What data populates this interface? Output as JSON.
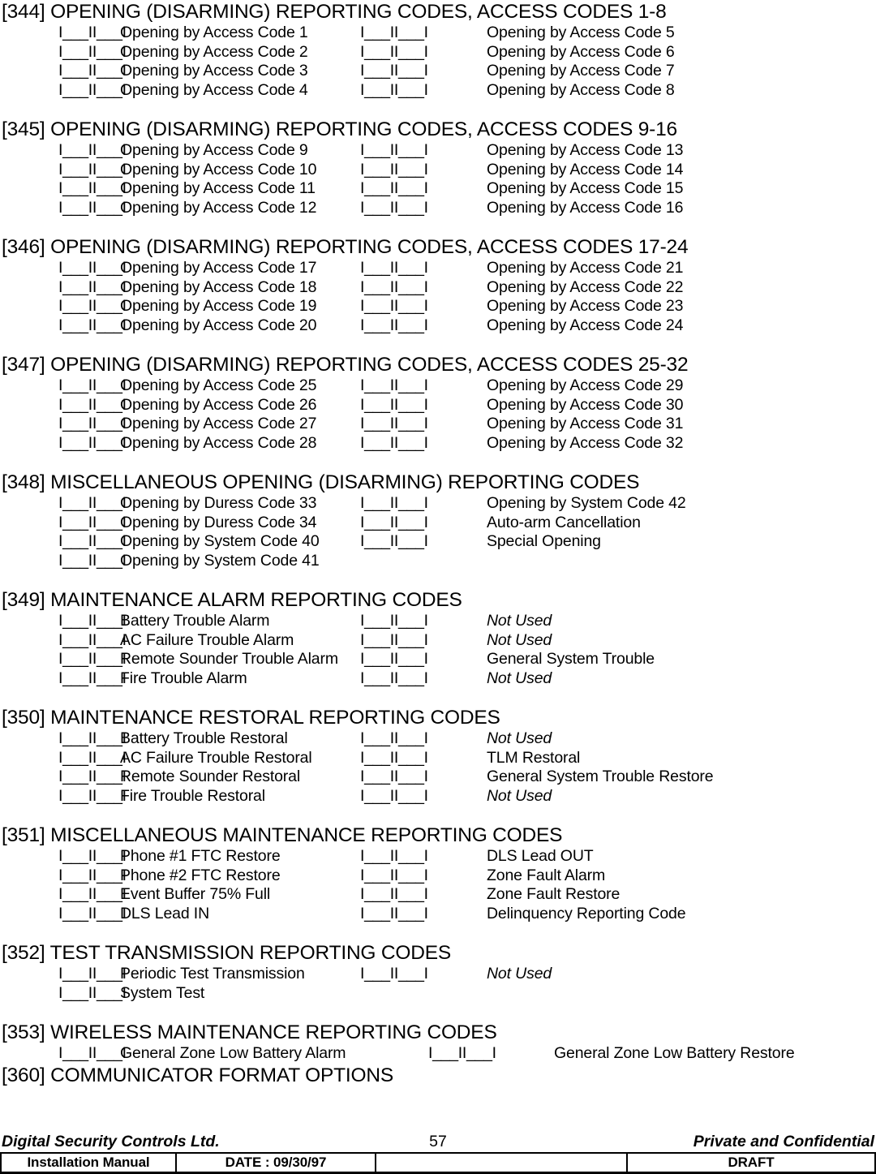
{
  "document": {
    "blank_field": "I___II___I",
    "page_number": "57"
  },
  "sections": [
    {
      "heading": "[344] OPENING (DISARMING) REPORTING CODES, ACCESS CODES 1-8",
      "rows": [
        {
          "c1": "Opening by Access Code 1",
          "c2": "Opening by Access Code 5"
        },
        {
          "c1": "Opening by Access Code 2",
          "c2": "Opening by Access Code 6"
        },
        {
          "c1": "Opening by Access Code 3",
          "c2": "Opening by Access Code 7"
        },
        {
          "c1": "Opening by Access Code 4",
          "c2": "Opening by Access Code 8"
        }
      ]
    },
    {
      "heading": "[345] OPENING (DISARMING) REPORTING CODES, ACCESS CODES 9-16",
      "rows": [
        {
          "c1": "Opening by Access Code 9",
          "c2": "Opening by Access Code 13"
        },
        {
          "c1": "Opening by Access Code 10",
          "c2": "Opening by Access Code 14"
        },
        {
          "c1": "Opening by Access Code 11",
          "c2": "Opening by Access Code 15"
        },
        {
          "c1": "Opening by Access Code 12",
          "c2": "Opening by Access Code 16"
        }
      ]
    },
    {
      "heading": "[346] OPENING (DISARMING) REPORTING CODES, ACCESS CODES 17-24",
      "rows": [
        {
          "c1": "Opening by Access Code 17",
          "c2": "Opening by Access Code 21"
        },
        {
          "c1": "Opening by Access Code 18",
          "c2": "Opening by Access Code 22"
        },
        {
          "c1": "Opening by Access Code 19",
          "c2": "Opening by Access Code 23"
        },
        {
          "c1": "Opening by Access Code 20",
          "c2": "Opening by Access Code 24"
        }
      ]
    },
    {
      "heading": "[347] OPENING (DISARMING) REPORTING CODES, ACCESS CODES 25-32",
      "rows": [
        {
          "c1": "Opening by Access Code 25",
          "c2": "Opening by Access Code 29"
        },
        {
          "c1": "Opening by Access Code 26",
          "c2": "Opening by Access Code 30"
        },
        {
          "c1": "Opening by Access Code 27",
          "c2": "Opening by Access Code 31"
        },
        {
          "c1": "Opening by Access Code 28",
          "c2": "Opening by Access Code 32"
        }
      ]
    },
    {
      "heading": "[348] MISCELLANEOUS OPENING (DISARMING) REPORTING CODES",
      "rows": [
        {
          "c1": "Opening by Duress Code 33",
          "c2": "Opening by System Code 42"
        },
        {
          "c1": "Opening by Duress Code 34",
          "c2": "Auto-arm Cancellation"
        },
        {
          "c1": "Opening by System Code 40",
          "c2": "Special Opening"
        },
        {
          "c1": "Opening by System Code 41",
          "c2": null
        }
      ]
    },
    {
      "heading": "[349] MAINTENANCE ALARM REPORTING CODES",
      "rows": [
        {
          "c1": "Battery Trouble Alarm",
          "c2": "Not Used",
          "c2_italic": true
        },
        {
          "c1": "AC Failure Trouble Alarm",
          "c2": "Not Used",
          "c2_italic": true
        },
        {
          "c1": "Remote Sounder Trouble Alarm",
          "c2": "General System Trouble"
        },
        {
          "c1": "Fire Trouble Alarm",
          "c2": "Not Used",
          "c2_italic": true
        }
      ]
    },
    {
      "heading": "[350] MAINTENANCE RESTORAL REPORTING CODES",
      "rows": [
        {
          "c1": "Battery Trouble Restoral",
          "c2": "Not Used",
          "c2_italic": true
        },
        {
          "c1": "AC Failure Trouble Restoral",
          "c2": "TLM Restoral"
        },
        {
          "c1": "Remote Sounder Restoral",
          "c2": "General System Trouble Restore"
        },
        {
          "c1": "Fire Trouble Restoral",
          "c2": "Not Used",
          "c2_italic": true
        }
      ]
    },
    {
      "heading": "[351] MISCELLANEOUS MAINTENANCE REPORTING CODES",
      "rows": [
        {
          "c1": "Phone #1 FTC Restore",
          "c2": "DLS Lead OUT"
        },
        {
          "c1": "Phone #2 FTC Restore",
          "c2": "Zone Fault Alarm"
        },
        {
          "c1": "Event Buffer 75% Full",
          "c2": "Zone Fault Restore"
        },
        {
          "c1": "DLS Lead IN",
          "c2": "Delinquency Reporting Code"
        }
      ]
    },
    {
      "heading": "[352] TEST TRANSMISSION REPORTING CODES",
      "rows": [
        {
          "c1": "Periodic Test Transmission",
          "c2": "Not Used",
          "c2_italic": true
        },
        {
          "c1": "System Test",
          "c2": null
        }
      ]
    },
    {
      "heading": "[353] WIRELESS MAINTENANCE REPORTING CODES",
      "wide": true,
      "rows": [
        {
          "c1": "General Zone Low Battery Alarm",
          "c2": "General Zone Low Battery Restore"
        }
      ]
    },
    {
      "heading": "[360] COMMUNICATOR FORMAT OPTIONS",
      "rows": []
    }
  ],
  "footer": {
    "company": "Digital Security Controls Ltd.",
    "page_number": "57",
    "confidentiality": "Private and Confidential",
    "table": [
      "Installation Manual",
      "DATE :  09/30/97",
      "",
      "DRAFT"
    ]
  }
}
